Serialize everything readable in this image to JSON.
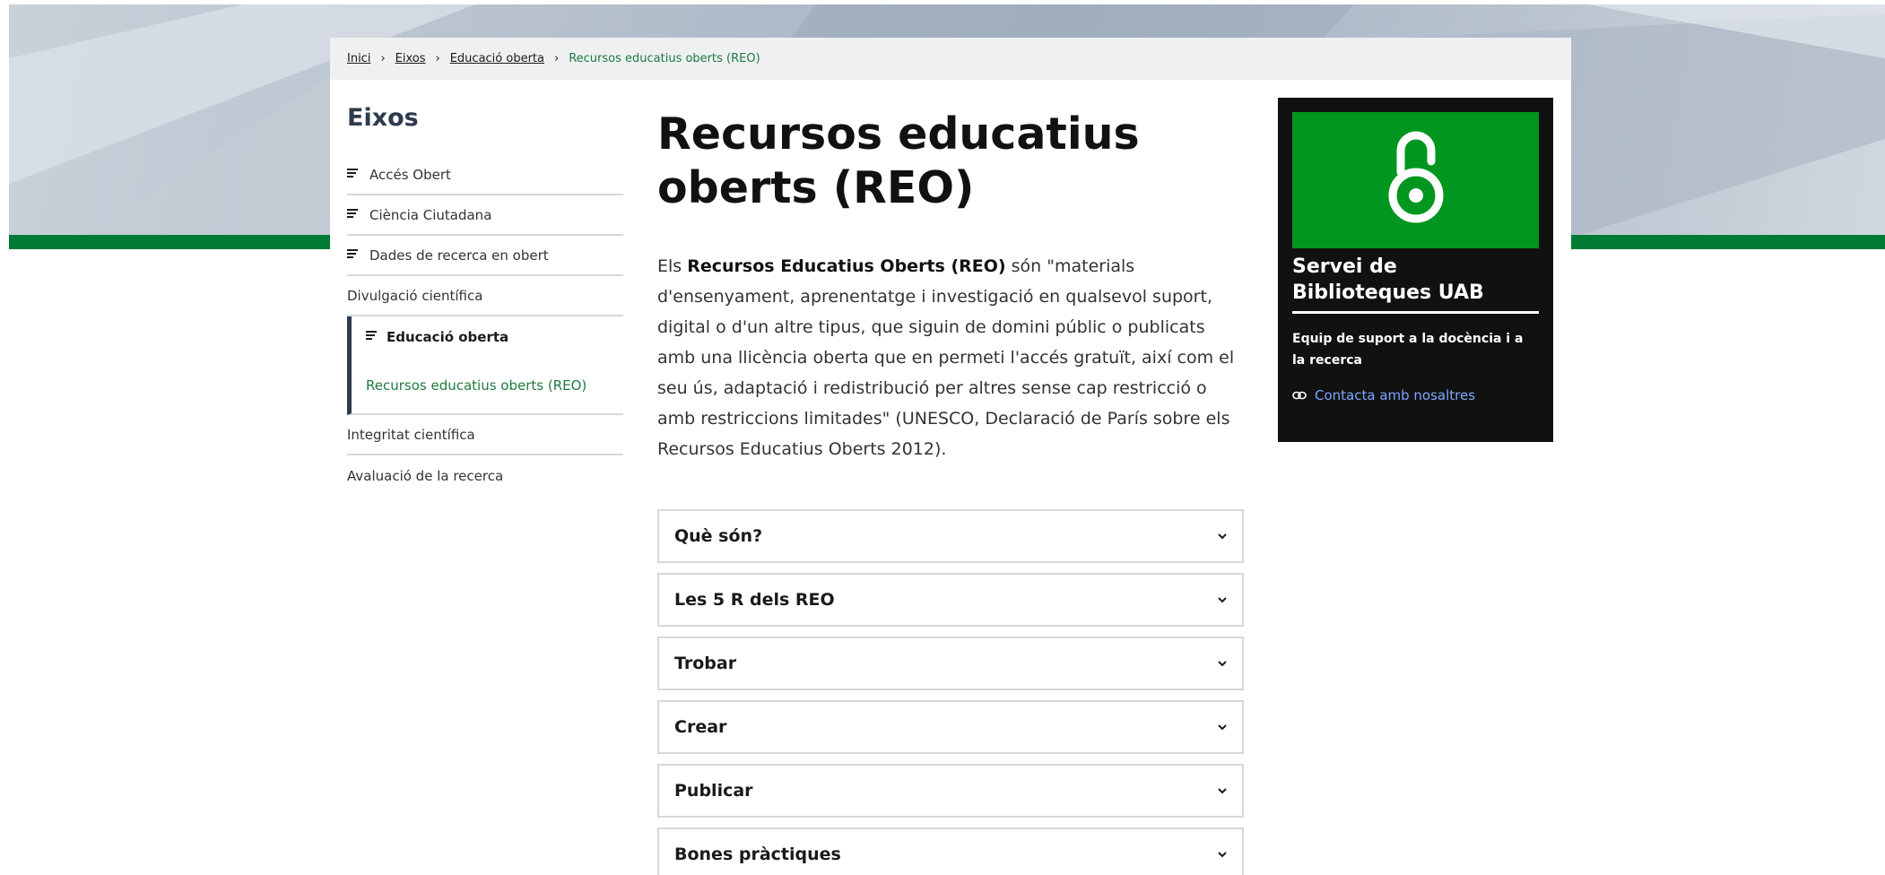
{
  "breadcrumb": {
    "items": [
      "Inici",
      "Eixos",
      "Educació oberta"
    ],
    "current": "Recursos educatius oberts (REO)",
    "separator": "›"
  },
  "sidebar": {
    "title": "Eixos",
    "items": [
      {
        "label": "Accés Obert",
        "icon": "list-icon"
      },
      {
        "label": "Ciència Ciutadana",
        "icon": "list-icon"
      },
      {
        "label": "Dades de recerca en obert",
        "icon": "list-icon"
      },
      {
        "label": "Divulgació científica"
      }
    ],
    "active": {
      "label": "Educació oberta",
      "icon": "list-icon",
      "child": "Recursos educatius oberts (REO)"
    },
    "after": [
      {
        "label": "Integritat científica"
      },
      {
        "label": "Avaluació de la recerca"
      }
    ]
  },
  "main": {
    "title": "Recursos educatius oberts (REO)",
    "intro_prefix": "Els ",
    "intro_bold": "Recursos Educatius Oberts (REO)",
    "intro_rest": " són \"materials d'ensenyament, aprenentatge i investigació en qualsevol suport, digital o d'un altre tipus, que siguin de domini públic o publicats amb una llicència oberta que en permeti l'accés gratuït, així com el seu ús, adaptació i redistribució per altres sense cap restricció o amb restriccions limitades\" (UNESCO, Declaració de París sobre els Recursos Educatius Oberts 2012).",
    "accordions": [
      "Què són?",
      "Les 5 R dels REO",
      "Trobar",
      "Crear",
      "Publicar",
      "Bones pràctiques"
    ]
  },
  "infocard": {
    "icon": "open-access-lock-icon",
    "title": "Servei de Biblioteques UAB",
    "subtitle": "Equip de suport a la docència i a la recerca",
    "link_icon": "link-icon",
    "link_label": "Contacta amb nosaltres"
  },
  "colors": {
    "accent_green": "#007b36",
    "oa_green": "#00961f",
    "active_link_green": "#1f7a3f",
    "dark_card": "#111111",
    "link_blue": "#7ea6ff"
  }
}
